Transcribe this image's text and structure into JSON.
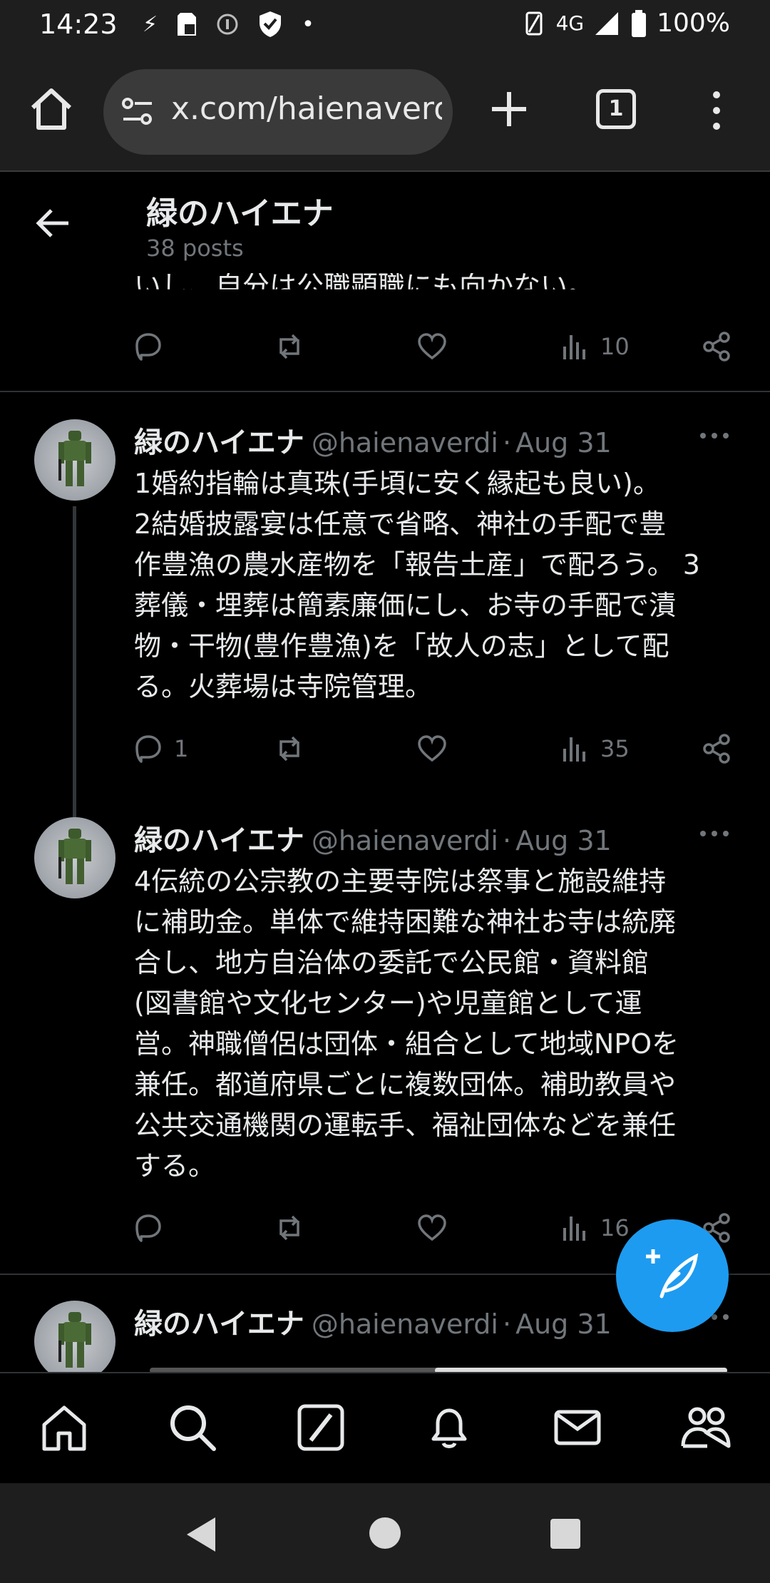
{
  "status_bar": {
    "time": "14:23",
    "network": "4G",
    "battery": "100%",
    "icons": [
      "usb-icon",
      "sd-card-icon",
      "info-icon",
      "shield-icon",
      "dot-icon",
      "vibrate-icon",
      "signal-icon",
      "battery-icon"
    ]
  },
  "browser": {
    "url": "x.com/haienaverdi",
    "tab_count": "1"
  },
  "profile": {
    "name": "緑のハイエナ",
    "post_count": "38 posts"
  },
  "partial_post": {
    "text_tail": "いし、自分は公職顕職にも向かない。",
    "views": "10"
  },
  "posts": [
    {
      "name": "緑のハイエナ",
      "handle": "@haienaverdi",
      "separator": "·",
      "date": "Aug 31",
      "text": "1婚約指輪は真珠(手頃に安く縁起も良い)。\n2結婚披露宴は任意で省略、神社の手配で豊\n作豊漁の農水産物を「報告土産」で配ろう。 3\n葬儀・埋葬は簡素廉価にし、お寺の手配で漬\n物・干物(豊作豊漁)を「故人の志」として配\nる。火葬場は寺院管理。",
      "replies": "1",
      "views": "35"
    },
    {
      "name": "緑のハイエナ",
      "handle": "@haienaverdi",
      "separator": "·",
      "date": "Aug 31",
      "text": "4伝統の公宗教の主要寺院は祭事と施設維持\nに補助金。単体で維持困難な神社お寺は統廃\n合し、地方自治体の委託で公民館・資料館\n(図書館や文化センター)や児童館として運\n営。神職僧侶は団体・組合として地域NPOを\n兼任。都道府県ごとに複数団体。補助教員や\n公共交通機関の運転手、福祉団体などを兼任\nする。",
      "replies": "",
      "views": "16"
    },
    {
      "name": "緑のハイエナ",
      "handle": "@haienaverdi",
      "separator": "·",
      "date": "Aug 31"
    }
  ],
  "colors": {
    "background": "#000000",
    "text": "#e7e9ea",
    "muted": "#71767b",
    "accent": "#1d9bf0",
    "chrome": "#1e1e1e"
  }
}
